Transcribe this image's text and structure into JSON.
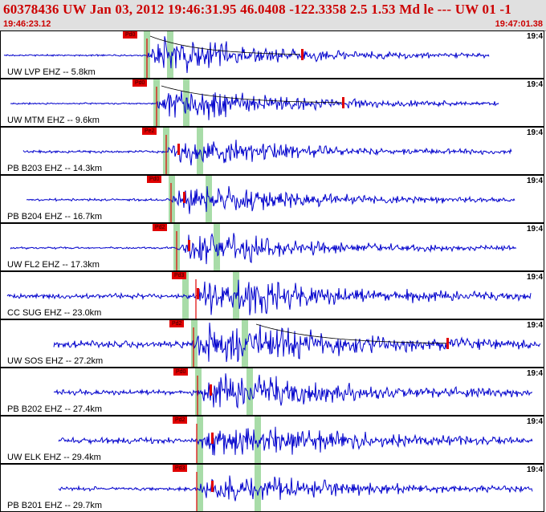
{
  "header": {
    "title": "60378436 UW Jan 03, 2012 19:46:31.95   46.0408 -122.3358  2.5 1.53 Md le --- UW 01  -1",
    "start_time": "19:46:23.12",
    "end_time": "19:47:01.38"
  },
  "colors": {
    "trace": "#0000cc",
    "pick": "#e00000",
    "phase_band": "#a8dca8",
    "header_bg": "#e0e0e0",
    "header_text": "#cc0000"
  },
  "traces": [
    {
      "label": "UW LVP EHZ -- 5.8km",
      "pick_label": "Pd0",
      "time_tag": "19:4"
    },
    {
      "label": "UW MTM EHZ -- 9.6km",
      "pick_label": "Pd0",
      "time_tag": "19:4"
    },
    {
      "label": "PB B203 EHZ -- 14.3km",
      "pick_label": "Pe2",
      "time_tag": "19:4"
    },
    {
      "label": "PB B204 EHZ -- 16.7km",
      "pick_label": "Pd0",
      "time_tag": "19:4"
    },
    {
      "label": "UW FL2 EHZ -- 17.3km",
      "pick_label": "Pd2",
      "time_tag": "19:4"
    },
    {
      "label": "CC SUG EHZ -- 23.0km",
      "pick_label": "Pd3",
      "time_tag": "19:4"
    },
    {
      "label": "UW SOS EHZ -- 27.2km",
      "pick_label": "Pd2",
      "time_tag": "19:4"
    },
    {
      "label": "PB B202 EHZ -- 27.4km",
      "pick_label": "Pd0",
      "time_tag": "19:4"
    },
    {
      "label": "UW ELK EHZ -- 29.4km",
      "pick_label": "Pd2",
      "time_tag": "19:4"
    },
    {
      "label": "PB B201 EHZ -- 29.7km",
      "pick_label": "Pd3",
      "time_tag": "19:4"
    }
  ]
}
